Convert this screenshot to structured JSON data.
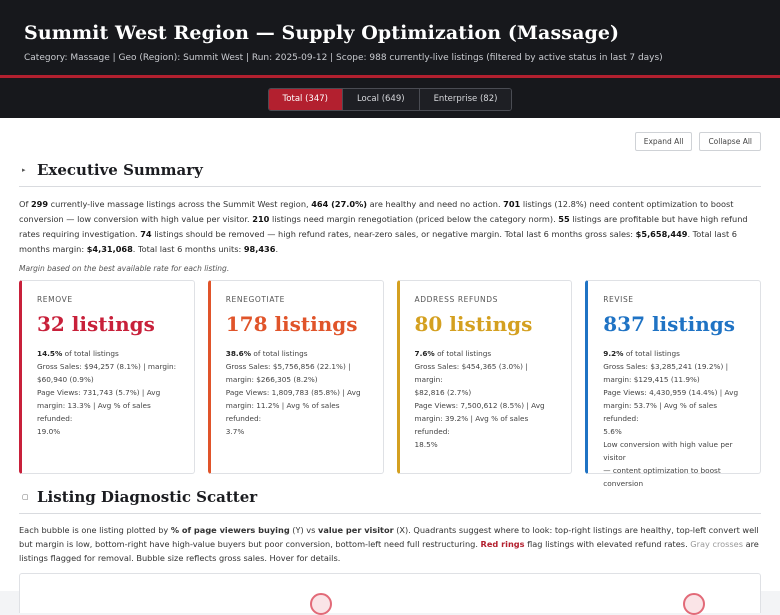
{
  "header": {
    "title": "Summit West Region — Supply Optimization (Massage)",
    "subtitle": "Category: Massage  |  Geo (Region): Summit West  |  Run: 2025-09-12  |  Scope: 988 currently-live listings (filtered by active status in last 7 days)"
  },
  "tabs": [
    {
      "label": "Total (347)"
    },
    {
      "label": "Local (649)"
    },
    {
      "label": "Enterprise (82)"
    }
  ],
  "controls": {
    "expand": "Expand All",
    "collapse": "Collapse All"
  },
  "exec": {
    "chevron": "▸",
    "title": "Executive Summary",
    "p_of": "Of ",
    "p_total": "299",
    "p_a": " currently-live massage listings across the Summit West region, ",
    "p_healthy": "464 (27.0%)",
    "p_b": " are healthy and need no action. ",
    "p_optimize": "701",
    "p_c": " listings (12.8%) need content optimization to boost conversion — low conversion with high value per visitor. ",
    "p_margin": "210",
    "p_d": " listings need margin renegotiation (priced below the category norm). ",
    "p_refund": "55",
    "p_e": " listings are profitable but have high refund rates requiring investigation. ",
    "p_remove": "74",
    "p_f": " listings should be removed — high refund rates, near-zero sales, or negative margin. Total last 6 months gross sales: ",
    "p_sales": "$5,658,449",
    "p_g": ". Total last 6 months margin: ",
    "p_marginv": "$4,31,068",
    "p_h": ". Total last 6 months units: ",
    "p_units": "98,436",
    "p_i": ".",
    "note": "Margin based on the best available rate for each listing."
  },
  "cards": [
    {
      "label": "REMOVE",
      "big": "32 listings",
      "color": "#c8203a",
      "pct": "14.5%",
      "pct_suffix": " of total listings",
      "lines": [
        "Gross Sales: $94,257 (8.1%)  |  margin:",
        "$60,940 (0.9%)",
        "Page Views: 731,743 (5.7%)  |  Avg",
        "margin: 13.3%  |  Avg % of sales refunded:",
        "19.0%"
      ]
    },
    {
      "label": "RENEGOTIATE",
      "big": "178 listings",
      "color": "#e0542a",
      "pct": "38.6%",
      "pct_suffix": " of total listings",
      "lines": [
        "Gross Sales: $5,756,856 (22.1%)  |",
        "margin: $266,305 (8.2%)",
        "Page Views: 1,809,783 (85.8%)  |  Avg",
        "margin: 11.2%  |  Avg % of sales refunded:",
        "3.7%"
      ]
    },
    {
      "label": "ADDRESS REFUNDS",
      "big": "80 listings",
      "color": "#d4a020",
      "pct": "7.6%",
      "pct_suffix": " of total listings",
      "lines": [
        "Gross Sales: $454,365 (3.0%)  |  margin:",
        "$82,816 (2.7%)",
        "Page Views: 7,500,612 (8.5%)  |  Avg",
        "margin: 39.2%  |  Avg % of sales refunded:",
        "18.5%"
      ]
    },
    {
      "label": "REVISE",
      "big": "837 listings",
      "color": "#1f73c4",
      "pct": "9.2%",
      "pct_suffix": " of total listings",
      "lines": [
        "Gross Sales: $3,285,241 (19.2%)  |",
        "margin: $129,415 (11.9%)",
        "Page Views: 4,430,959 (14.4%)  |  Avg",
        "margin: 53.7%  |  Avg % of sales refunded:",
        "5.6%",
        "Low conversion with high value per visitor",
        "— content optimization to boost",
        "conversion"
      ]
    }
  ],
  "scatter": {
    "chevron": "▢",
    "title": "Listing Diagnostic Scatter",
    "d_a": "Each bubble is one listing plotted by ",
    "d_y": "% of page viewers buying",
    "d_b": " (Y) vs ",
    "d_x": "value per visitor",
    "d_c": " (X). Quadrants suggest where to look: top-right listings are healthy, top-left convert well but margin is low, bottom-right have high-value buyers but poor conversion, bottom-left need full restructuring. ",
    "d_red": "Red rings",
    "d_d": " flag listings with elevated refund rates. ",
    "d_gray": "Gray crosses",
    "d_e": " are listings flagged for removal. Bubble size reflects gross sales. Hover for details."
  }
}
